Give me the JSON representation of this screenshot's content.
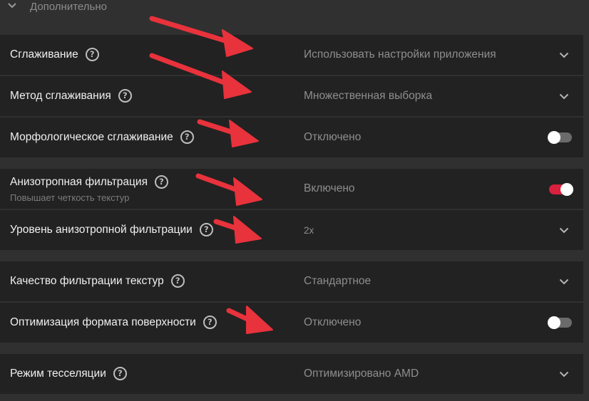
{
  "section": {
    "title": "Дополнительно",
    "icon": "chevron-down-icon"
  },
  "settings": [
    {
      "label": "Сглаживание",
      "value": "Использовать настройки приложения",
      "control": "dropdown"
    },
    {
      "label": "Метод сглаживания",
      "value": "Множественная выборка",
      "control": "dropdown"
    },
    {
      "label": "Морфологическое сглаживание",
      "value": "Отключено",
      "control": "toggle",
      "state": "off"
    },
    {
      "label": "Анизотропная фильтрация",
      "sublabel": "Повышает четкость текстур",
      "value": "Включено",
      "control": "toggle",
      "state": "on"
    },
    {
      "label": "Уровень анизотропной фильтрации",
      "value": "2x",
      "control": "dropdown"
    },
    {
      "label": "Качество фильтрации текстур",
      "value": "Стандартное",
      "control": "dropdown"
    },
    {
      "label": "Оптимизация формата поверхности",
      "value": "Отключено",
      "control": "toggle",
      "state": "off"
    },
    {
      "label": "Режим тесселяции",
      "value": "Оптимизировано AMD",
      "control": "dropdown"
    }
  ],
  "colors": {
    "background": "#303030",
    "row": "#222222",
    "toggle_on": "#d8213e",
    "annotation_arrow": "#e8323c"
  }
}
